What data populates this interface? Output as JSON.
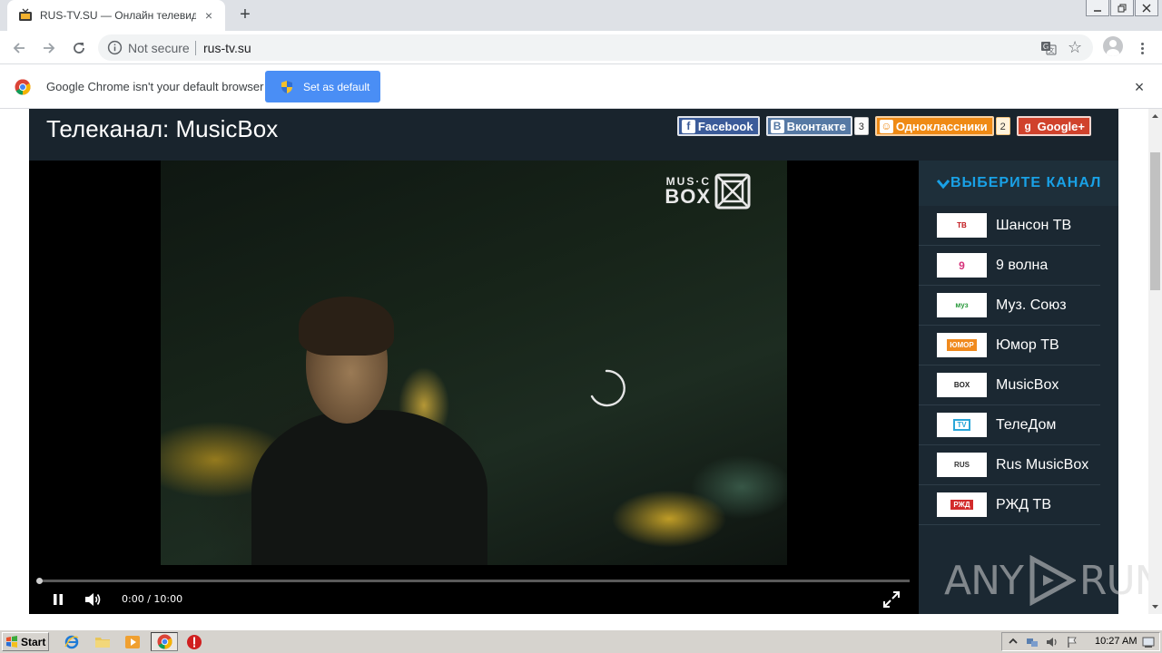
{
  "browser": {
    "tab_title": "RUS-TV.SU — Онлайн телевидение",
    "tab_close": "×",
    "new_tab": "+",
    "security_label": "Not secure",
    "url": "rus-tv.su"
  },
  "infobar": {
    "message": "Google Chrome isn't your default browser",
    "button_label": "Set as default",
    "close": "×"
  },
  "page": {
    "channel_title": "Телеканал: MusicBox",
    "social": [
      {
        "label": "Facebook",
        "icon": "f",
        "count": null
      },
      {
        "label": "Вконтакте",
        "icon": "B",
        "count": "3"
      },
      {
        "label": "Одноклассники",
        "icon": "ok",
        "count": "2"
      },
      {
        "label": "Google+",
        "icon": "g",
        "count": null
      }
    ],
    "video": {
      "logo_line1": "MUS·C",
      "logo_line2": "BOX",
      "time": "0:00 / 10:00",
      "progress": 0,
      "state": "playing"
    },
    "sidebar": {
      "title": "ВЫБЕРИТЕ КАНАЛ",
      "channels": [
        {
          "name": "Шансон ТВ",
          "thumb": "ТВ",
          "thumb_color": "#c0161b"
        },
        {
          "name": "9 волна",
          "thumb": "9",
          "thumb_color": "#d6317a"
        },
        {
          "name": "Муз. Союз",
          "thumb": "муз",
          "thumb_color": "#2a9a3c"
        },
        {
          "name": "Юмор ТВ",
          "thumb": "ЮМОР",
          "thumb_color": "#f08a1e"
        },
        {
          "name": "MusicBox",
          "thumb": "BOX",
          "thumb_color": "#222222"
        },
        {
          "name": "ТелеДом",
          "thumb": "TV",
          "thumb_color": "#2aa6d8"
        },
        {
          "name": "Rus MusicBox",
          "thumb": "RUS",
          "thumb_color": "#333333"
        },
        {
          "name": "РЖД ТВ",
          "thumb": "РЖД",
          "thumb_color": "#d22b2b"
        }
      ]
    },
    "watermark_left": "ANY",
    "watermark_right": "RUN"
  },
  "taskbar": {
    "start_label": "Start",
    "clock": "10:27 AM"
  },
  "colors": {
    "accent_blue": "#19a1e6",
    "page_bg": "#19242d",
    "default_button": "#4a8ef5"
  }
}
